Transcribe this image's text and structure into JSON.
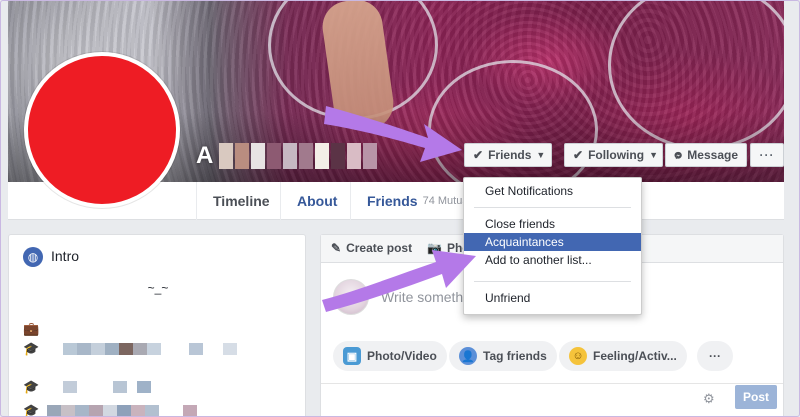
{
  "profile": {
    "name_initial": "A",
    "tabs": {
      "timeline": "Timeline",
      "about": "About",
      "friends": "Friends",
      "friends_count": "74 Mutual"
    }
  },
  "actions": {
    "friends": "Friends",
    "following": "Following",
    "message": "Message",
    "more": "···"
  },
  "dropdown": {
    "items": [
      "Get Notifications",
      "Close friends",
      "Acquaintances",
      "Add to another list...",
      "Unfriend"
    ],
    "selected": "Acquaintances"
  },
  "intro": {
    "title": "Intro",
    "bio": "~_~"
  },
  "composer": {
    "create_post": "Create post",
    "photo_tab": "Pho",
    "placeholder": "Write somethin",
    "photo_video": "Photo/Video",
    "tag_friends": "Tag friends",
    "feeling": "Feeling/Activ...",
    "more": "···",
    "post": "Post"
  },
  "colors": {
    "fb_blue": "#4267b2",
    "link_blue": "#365899",
    "avatar_red": "#ee1c24",
    "annotation_purple": "#b479e8"
  },
  "icons": {
    "intro": "globe-icon",
    "work": "briefcase-icon",
    "education": "graduation-cap-icon",
    "create_post": "pencil-icon",
    "photo": "camera-icon",
    "settings": "gear-icon",
    "check": "check-icon",
    "message": "messenger-icon"
  }
}
